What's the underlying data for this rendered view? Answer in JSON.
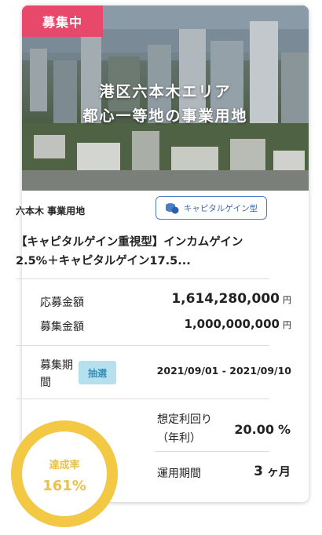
{
  "status_badge": "募集中",
  "hero": {
    "line1": "港区六本木エリア",
    "line2": "都心一等地の事業用地"
  },
  "location": "六本木 事業用地",
  "fund_type": {
    "label": "キャピタルゲイン型",
    "icon": "coins-icon"
  },
  "title": "【キャピタルゲイン重視型】インカムゲイン2.5%＋キャピタルゲイン17.5...",
  "applied_amount": {
    "label": "応募金額",
    "value": "1,614,280,000",
    "unit": "円"
  },
  "target_amount": {
    "label": "募集金額",
    "value": "1,000,000,000",
    "unit": "円"
  },
  "period": {
    "label": "募集期間",
    "method": "抽選",
    "range": "2021/09/01 - 2021/09/10"
  },
  "expected_yield": {
    "label": "想定利回り",
    "sub_label": "（年利）",
    "value": "20.00",
    "unit": "%"
  },
  "operation_period": {
    "label": "運用期間",
    "value": "3",
    "unit": "ヶ月"
  },
  "achievement": {
    "label": "達成率",
    "value": "161%",
    "fraction": 1.0
  },
  "colors": {
    "badge": "#e8496b",
    "accent_blue": "#4a7fc6",
    "lottery_bg": "#b6e0ee",
    "progress": "#f2c845"
  }
}
